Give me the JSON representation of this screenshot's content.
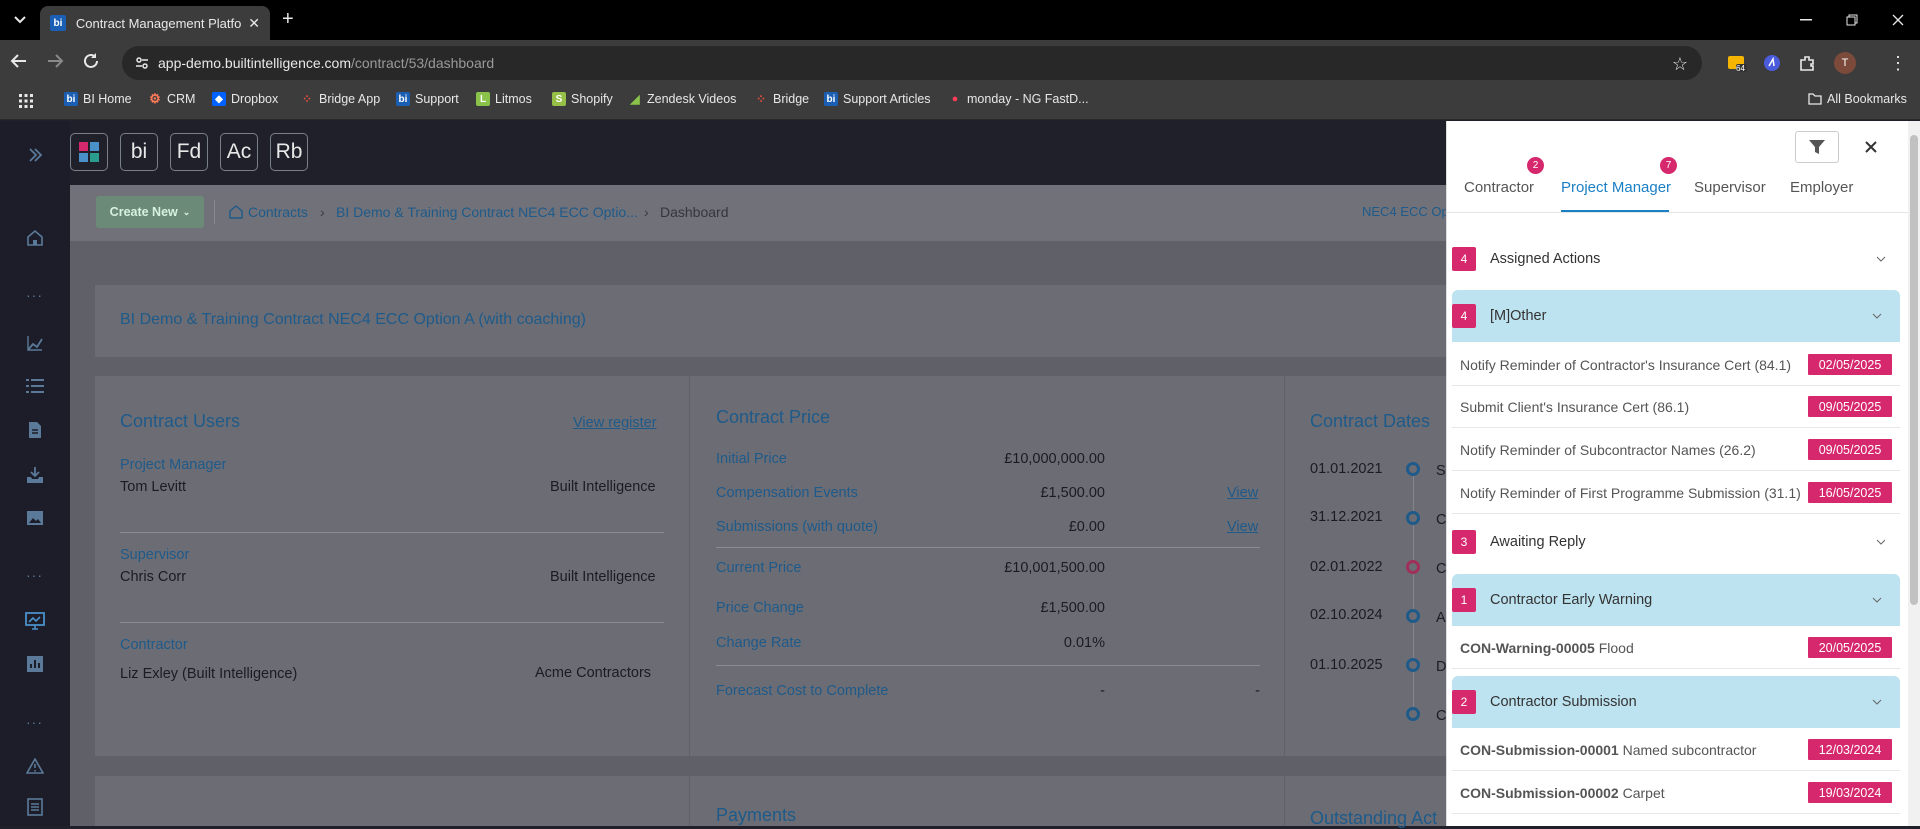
{
  "browser": {
    "tab_title": "Contract Management Platform",
    "url_host": "app-demo.builtintelligence.com",
    "url_path": "/contract/53/dashboard",
    "extension_badge": "64",
    "profile_initial": "T",
    "bookmarks": [
      "BI Home",
      "CRM",
      "Dropbox",
      "Bridge App",
      "Support",
      "Litmos",
      "Shopify",
      "Zendesk Videos",
      "Bridge",
      "Support Articles",
      "monday - NG FastD..."
    ],
    "all_bookmarks": "All Bookmarks"
  },
  "header": {
    "buttons": [
      "bi",
      "Fd",
      "Ac",
      "Rb"
    ]
  },
  "toolbar": {
    "create_new": "Create New",
    "crumbs": [
      "Contracts",
      "BI Demo & Training Contract NEC4 ECC Optio...",
      "Dashboard"
    ],
    "contract_type": "NEC4 ECC Op"
  },
  "contract_title": "BI Demo & Training Contract NEC4 ECC Option A (with coaching)",
  "contract_users": {
    "title": "Contract Users",
    "view_register": "View register",
    "users": [
      {
        "role": "Project Manager",
        "name": "Tom Levitt",
        "company": "Built Intelligence"
      },
      {
        "role": "Supervisor",
        "name": "Chris Corr",
        "company": "Built Intelligence"
      },
      {
        "role": "Contractor",
        "name": "Liz Exley (Built Intelligence)",
        "company": "Acme Contractors"
      }
    ]
  },
  "contract_price": {
    "title": "Contract Price",
    "rows": [
      {
        "label": "Initial Price",
        "value": "£10,000,000.00",
        "link": ""
      },
      {
        "label": "Compensation Events",
        "value": "£1,500.00",
        "link": "View"
      },
      {
        "label": "Submissions (with quote)",
        "value": "£0.00",
        "link": "View"
      },
      {
        "label": "Current Price",
        "value": "£10,001,500.00",
        "link": ""
      },
      {
        "label": "Price Change",
        "value": "£1,500.00",
        "link": ""
      },
      {
        "label": "Change Rate",
        "value": "0.01%",
        "link": ""
      },
      {
        "label": "Forecast Cost to Complete",
        "value": "-",
        "link": "-"
      }
    ]
  },
  "contract_dates": {
    "title": "Contract Dates",
    "dates": [
      {
        "date": "01.01.2021",
        "initial": "S"
      },
      {
        "date": "31.12.2021",
        "initial": "C"
      },
      {
        "date": "02.01.2022",
        "initial": "C"
      },
      {
        "date": "02.10.2024",
        "initial": "A"
      },
      {
        "date": "01.10.2025",
        "initial": "D"
      },
      {
        "date": "",
        "initial": "C"
      }
    ]
  },
  "bottom": {
    "payments": "Payments",
    "outstanding": "Outstanding Act"
  },
  "actions_panel": {
    "tabs": [
      {
        "label": "Contractor",
        "badge": "2"
      },
      {
        "label": "Project Manager",
        "badge": "7"
      },
      {
        "label": "Supervisor",
        "badge": ""
      },
      {
        "label": "Employer",
        "badge": ""
      }
    ],
    "assigned": {
      "count": "4",
      "label": "Assigned Actions"
    },
    "other": {
      "count": "4",
      "label": "[M]Other"
    },
    "other_items": [
      {
        "text": "Notify Reminder of Contractor's Insurance Cert (84.1)",
        "date": "02/05/2025"
      },
      {
        "text": "Submit Client's Insurance Cert (86.1)",
        "date": "09/05/2025"
      },
      {
        "text": "Notify Reminder of Subcontractor Names (26.2)",
        "date": "09/05/2025"
      },
      {
        "text": "Notify Reminder of First Programme Submission (31.1)",
        "date": "16/05/2025"
      }
    ],
    "awaiting": {
      "count": "3",
      "label": "Awaiting Reply"
    },
    "early_warning": {
      "count": "1",
      "label": "Contractor Early Warning"
    },
    "early_warning_items": [
      {
        "ref": "CON-Warning-00005",
        "text": "Flood",
        "date": "20/05/2025"
      }
    ],
    "submission": {
      "count": "2",
      "label": "Contractor Submission"
    },
    "submission_items": [
      {
        "ref": "CON-Submission-00001",
        "text": "Named subcontractor",
        "date": "12/03/2024"
      },
      {
        "ref": "CON-Submission-00002",
        "text": "Carpet",
        "date": "19/03/2024"
      }
    ]
  }
}
